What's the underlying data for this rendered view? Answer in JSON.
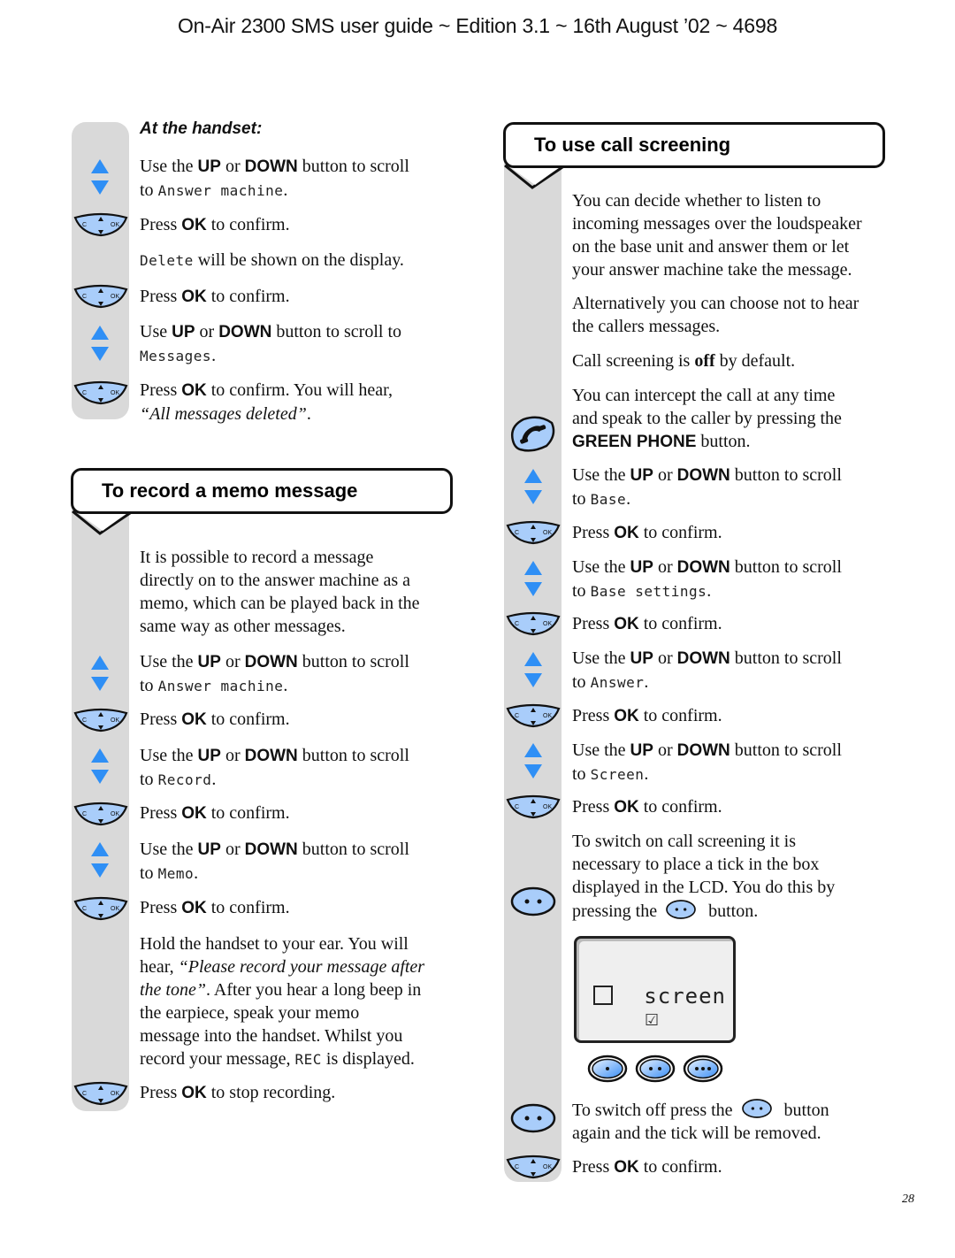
{
  "header": {
    "title": "On-Air 2300 SMS user guide ~ Edition 3.1 ~ 16th August ’02 ~ 4698"
  },
  "page_number": "28",
  "colors": {
    "rail": "#d9d9d9",
    "button_blue": "#a9cdfa",
    "arrow_blue": "#2f8ff5"
  },
  "left": {
    "subheading": "At the handset:",
    "steps1": [
      {
        "icon": "up-down-arrows-icon",
        "pre": "Use the ",
        "b1": "UP",
        "mid": " or ",
        "b2": "DOWN",
        "post": " button to scroll",
        "line2_pre": "to ",
        "lcd": "Answer machine",
        "line2_post": "."
      },
      {
        "icon": "ok-button-icon",
        "pre": "Press ",
        "b1": "OK",
        "post": " to confirm."
      },
      {
        "lcd": "Delete",
        "post": " will be shown on the display."
      },
      {
        "icon": "ok-button-icon",
        "pre": "Press ",
        "b1": "OK",
        "post": " to confirm."
      },
      {
        "icon": "up-down-arrows-icon",
        "pre": "Use ",
        "b1": "UP",
        "mid": " or ",
        "b2": "DOWN",
        "post": " button to scroll to",
        "lcd": "Messages",
        "line2_post": "."
      },
      {
        "icon": "ok-button-icon",
        "pre": "Press ",
        "b1": "OK",
        "post": " to confirm. You will hear,",
        "italic": "“All messages deleted”",
        "italic_post": "."
      }
    ],
    "section_title": "To record a memo message",
    "intro": [
      "It is possible to record a message",
      "directly on to the answer machine as a",
      "memo, which can be played back in the",
      "same way as other messages."
    ],
    "steps2": [
      {
        "pre": "Use the ",
        "b1": "UP",
        "mid": " or ",
        "b2": "DOWN",
        "post": " button to scroll",
        "line2_pre": "to ",
        "lcd": "Answer machine",
        "line2_post": "."
      },
      {
        "pre": "Press ",
        "b1": "OK",
        "post": " to confirm."
      },
      {
        "pre": "Use the ",
        "b1": "UP",
        "mid": " or ",
        "b2": "DOWN",
        "post": " button to scroll",
        "line2_pre": "to ",
        "lcd": "Record",
        "line2_post": "."
      },
      {
        "pre": "Press ",
        "b1": "OK",
        "post": " to confirm."
      },
      {
        "pre": "Use the ",
        "b1": "UP",
        "mid": " or ",
        "b2": "DOWN",
        "post": " button to scroll",
        "line2_pre": "to ",
        "lcd": "Memo",
        "line2_post": "."
      },
      {
        "pre": "Press ",
        "b1": "OK",
        "post": " to confirm."
      }
    ],
    "hold": {
      "l1": "Hold the handset to your ear. You will",
      "l2_pre": "hear, ",
      "l2_it": "“Please record your message after",
      "l3_it": "the tone”",
      "l3_post": ". After you hear a long beep in",
      "l4": "the earpiece, speak your memo",
      "l5": "message into the handset. Whilst you",
      "l6_pre": "record your message, ",
      "l6_lcd": "REC",
      "l6_post": " is displayed."
    },
    "stop": {
      "pre": "Press ",
      "b1": "OK",
      "post": " to stop recording."
    }
  },
  "right": {
    "section_title": "To use call screening",
    "p1": [
      "You can decide whether to listen to",
      "incoming messages over the loudspeaker",
      "on the base unit and answer them or let",
      "your answer machine take the message."
    ],
    "p2": [
      "Alternatively you can choose not to hear",
      "the callers messages."
    ],
    "p3": {
      "pre": "Call screening is ",
      "bold": "off",
      "post": " by default."
    },
    "p4": {
      "l1": "You can intercept the call at any time",
      "l2": "and speak to the caller by pressing the",
      "bold": "GREEN PHONE",
      "post": " button."
    },
    "steps": [
      {
        "pre": "Use the ",
        "b1": "UP",
        "mid": " or ",
        "b2": "DOWN",
        "post": " button to scroll",
        "line2_pre": "to ",
        "lcd": "Base",
        "line2_post": "."
      },
      {
        "pre": "Press ",
        "b1": "OK",
        "post": " to confirm."
      },
      {
        "pre": "Use the ",
        "b1": "UP",
        "mid": " or ",
        "b2": "DOWN",
        "post": " button to scroll",
        "line2_pre": "to ",
        "lcd": "Base settings",
        "line2_post": "."
      },
      {
        "pre": "Press ",
        "b1": "OK",
        "post": " to confirm."
      },
      {
        "pre": "Use the ",
        "b1": "UP",
        "mid": " or ",
        "b2": "DOWN",
        "post": " button to scroll",
        "line2_pre": "to ",
        "lcd": "Answer",
        "line2_post": "."
      },
      {
        "pre": "Press ",
        "b1": "OK",
        "post": " to confirm."
      },
      {
        "pre": "Use the ",
        "b1": "UP",
        "mid": " or ",
        "b2": "DOWN",
        "post": " button to scroll",
        "line2_pre": "to ",
        "lcd": "Screen",
        "line2_post": "."
      },
      {
        "pre": "Press ",
        "b1": "OK",
        "post": " to confirm."
      }
    ],
    "switch_on": [
      "To switch on call screening it is",
      "necessary to place a tick in the box",
      "displayed in the LCD. You do this by"
    ],
    "switch_on_last": {
      "pre": "pressing the ",
      "post": " button."
    },
    "lcd_display": {
      "label": "screen",
      "checkbox_checked": false,
      "tick_glyph": "☑"
    },
    "switch_off": {
      "pre": "To switch off press the ",
      "post": " button",
      "l2": "again and the tick will be removed."
    },
    "final": {
      "pre": "Press ",
      "b1": "OK",
      "post": " to confirm."
    }
  }
}
